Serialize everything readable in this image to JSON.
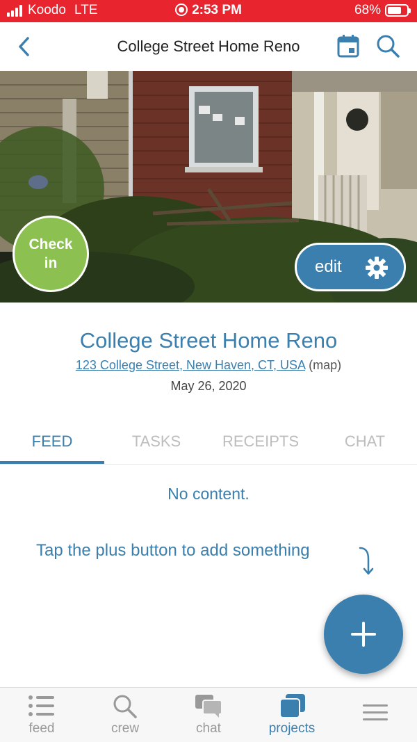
{
  "status_bar": {
    "carrier": "Koodo",
    "network": "LTE",
    "time": "2:53 PM",
    "battery": "68%"
  },
  "nav": {
    "title": "College Street Home Reno",
    "back_icon": "chevron-left-icon",
    "calendar_icon": "calendar-icon",
    "search_icon": "search-icon"
  },
  "hero": {
    "checkin_label_line1": "Check",
    "checkin_label_line2": "in",
    "edit_label": "edit",
    "gear_icon": "gear-icon"
  },
  "project": {
    "name": "College Street Home Reno",
    "address": "123 College Street, New Haven, CT, USA",
    "map_label": "(map)",
    "date": "May 26, 2020"
  },
  "tabs": [
    {
      "label": "FEED",
      "active": true
    },
    {
      "label": "TASKS",
      "active": false
    },
    {
      "label": "RECEIPTS",
      "active": false
    },
    {
      "label": "CHAT",
      "active": false
    }
  ],
  "feed": {
    "empty_message": "No content.",
    "hint": "Tap the plus button to add something"
  },
  "bottom_nav": [
    {
      "label": "feed",
      "icon": "list-icon",
      "active": false
    },
    {
      "label": "crew",
      "icon": "search-icon",
      "active": false
    },
    {
      "label": "chat",
      "icon": "chat-bubbles-icon",
      "active": false
    },
    {
      "label": "projects",
      "icon": "stacked-squares-icon",
      "active": true
    },
    {
      "label": "",
      "icon": "hamburger-menu-icon",
      "active": false
    }
  ],
  "colors": {
    "status_bar": "#e8242f",
    "accent": "#3a7fae",
    "checkin": "#8cc152",
    "inactive": "#999999"
  }
}
